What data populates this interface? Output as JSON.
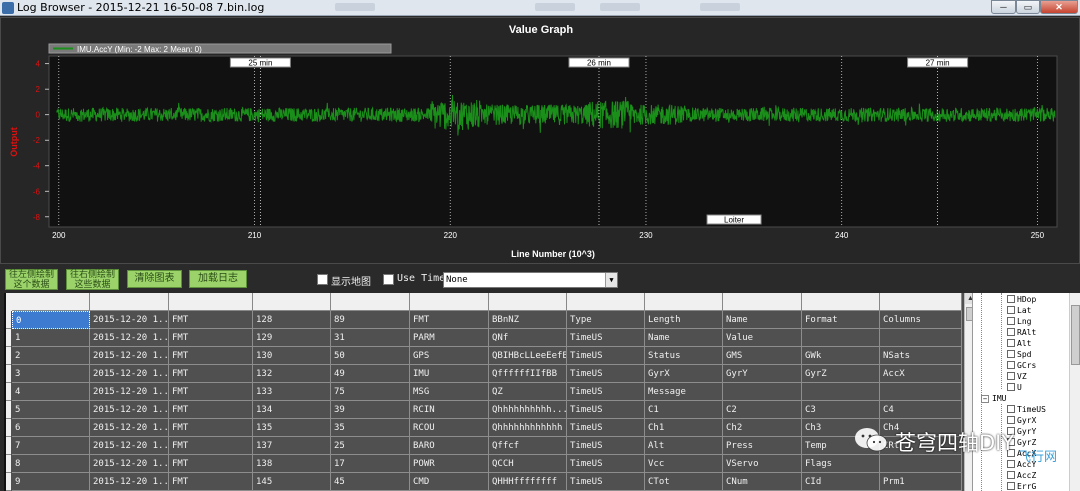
{
  "window": {
    "title": "Log Browser - 2015-12-21 16-50-08 7.bin.log",
    "minimize_glyph": "─",
    "maximize_glyph": "▭",
    "close_glyph": "✕"
  },
  "graph": {
    "title": "Value Graph",
    "legend_label": "IMU.AccY (Min: -2 Max: 2 Mean: 0)"
  },
  "chart_data": {
    "type": "line",
    "title": "Value Graph",
    "xlabel": "Line Number (10^3)",
    "ylabel": "Output",
    "xlim": [
      199.5,
      251
    ],
    "ylim": [
      -8.8,
      4.6
    ],
    "x_ticks": [
      "200",
      "210",
      "220",
      "230",
      "240",
      "250"
    ],
    "y_ticks": [
      "4",
      "2",
      "0",
      "-2",
      "-4",
      "-6",
      "-8"
    ],
    "grid": true,
    "series": [
      {
        "name": "IMU.AccY",
        "color": "#1a8f1a",
        "mean": 0,
        "min": -2,
        "max": 2
      }
    ],
    "time_markers": [
      {
        "x": 210.3,
        "label": "25 min"
      },
      {
        "x": 227.6,
        "label": "26 min"
      },
      {
        "x": 244.9,
        "label": "27 min"
      }
    ],
    "mode_markers": [
      {
        "x": 234.5,
        "label": "Loiter"
      }
    ]
  },
  "controls": {
    "btn_left": "往左侧绘制\n这个数据",
    "btn_right": "往右侧绘制\n这些数据",
    "btn_clear": "清除图表",
    "btn_load": "加载日志",
    "show_map_label": "显示地图",
    "use_time_label": "Use Time",
    "select_value": "None"
  },
  "table": {
    "rows": [
      [
        "0",
        "2015-12-20 1...",
        "FMT",
        "128",
        "89",
        "FMT",
        "BBnNZ",
        "Type",
        "Length",
        "Name",
        "Format",
        "Columns"
      ],
      [
        "1",
        "2015-12-20 1...",
        "FMT",
        "129",
        "31",
        "PARM",
        "QNf",
        "TimeUS",
        "Name",
        "Value",
        "",
        ""
      ],
      [
        "2",
        "2015-12-20 1...",
        "FMT",
        "130",
        "50",
        "GPS",
        "QBIHBcLLeeEefB",
        "TimeUS",
        "Status",
        "GMS",
        "GWk",
        "NSats"
      ],
      [
        "3",
        "2015-12-20 1...",
        "FMT",
        "132",
        "49",
        "IMU",
        "QffffffIIfBB",
        "TimeUS",
        "GyrX",
        "GyrY",
        "GyrZ",
        "AccX"
      ],
      [
        "4",
        "2015-12-20 1...",
        "FMT",
        "133",
        "75",
        "MSG",
        "QZ",
        "TimeUS",
        "Message",
        "",
        "",
        ""
      ],
      [
        "5",
        "2015-12-20 1...",
        "FMT",
        "134",
        "39",
        "RCIN",
        "Qhhhhhhhhhh...",
        "TimeUS",
        "C1",
        "C2",
        "C3",
        "C4"
      ],
      [
        "6",
        "2015-12-20 1...",
        "FMT",
        "135",
        "35",
        "RCOU",
        "Qhhhhhhhhhhhh",
        "TimeUS",
        "Ch1",
        "Ch2",
        "Ch3",
        "Ch4"
      ],
      [
        "7",
        "2015-12-20 1...",
        "FMT",
        "137",
        "25",
        "BARO",
        "Qffcf",
        "TimeUS",
        "Alt",
        "Press",
        "Temp",
        "CRt"
      ],
      [
        "8",
        "2015-12-20 1...",
        "FMT",
        "138",
        "17",
        "POWR",
        "QCCH",
        "TimeUS",
        "Vcc",
        "VServo",
        "Flags",
        ""
      ],
      [
        "9",
        "2015-12-20 1...",
        "FMT",
        "145",
        "45",
        "CMD",
        "QHHHffffffff",
        "TimeUS",
        "CTot",
        "CNum",
        "CId",
        "Prm1"
      ]
    ]
  },
  "tree": {
    "items_top": [
      "HDop",
      "Lat",
      "Lng",
      "RAlt",
      "Alt",
      "Spd",
      "GCrs",
      "VZ",
      "U"
    ],
    "group": "IMU",
    "items_bottom": [
      "TimeUS",
      "GyrX",
      "GyrY",
      "GyrZ",
      "AccX",
      "AccY",
      "AccZ",
      "ErrG"
    ]
  },
  "watermark": {
    "text": "苍穹四轴DIY",
    "text2": "飞行网"
  }
}
